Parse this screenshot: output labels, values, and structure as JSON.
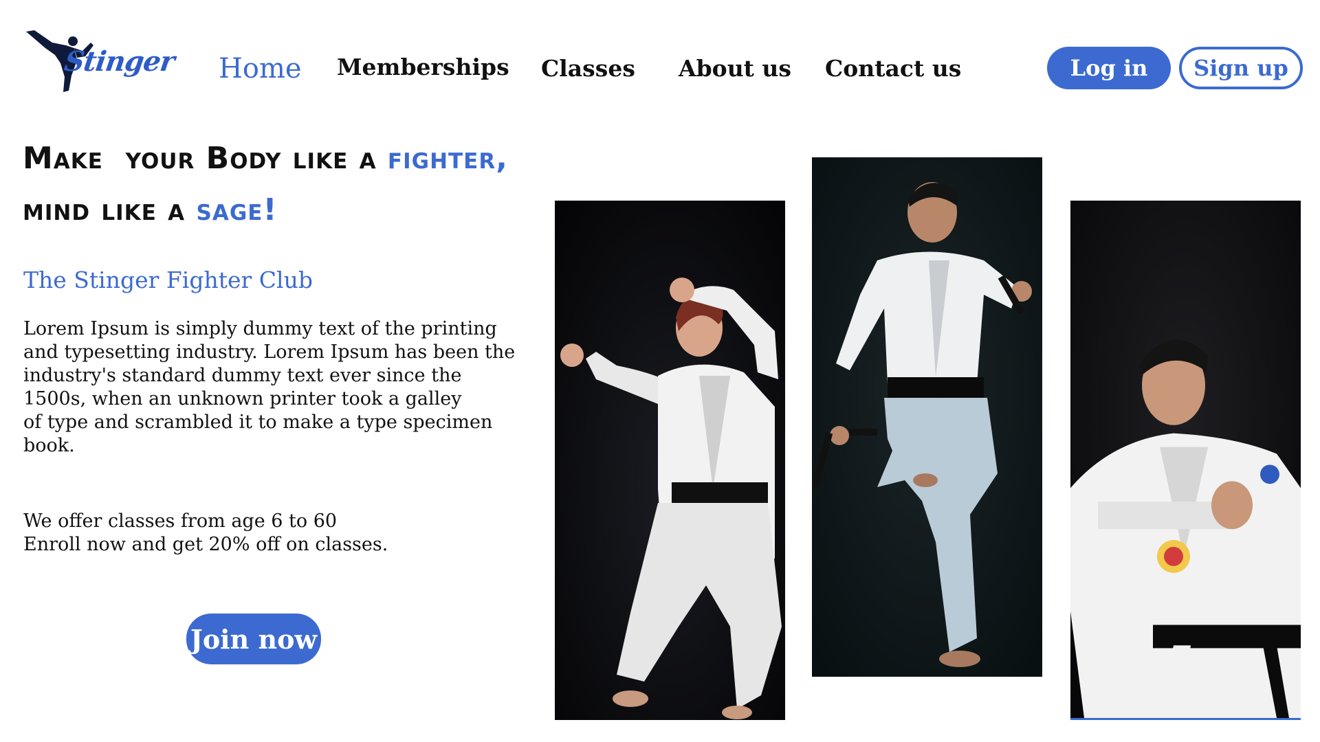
{
  "brand": {
    "logo_text": "Stinger",
    "logo_icon": "karate-kick-silhouette-icon"
  },
  "nav": {
    "items": [
      {
        "label": "Home",
        "active": true
      },
      {
        "label": "Memberships"
      },
      {
        "label": "Classes"
      },
      {
        "label": "About us"
      },
      {
        "label": "Contact us"
      }
    ],
    "login_label": "Log in",
    "signup_label": "Sign up"
  },
  "hero": {
    "headline_line1_prefix": "Make  your Body like a ",
    "headline_line1_accent": "fighter,",
    "headline_line2_prefix": "mind like a ",
    "headline_line2_accent": "sage!",
    "club_title": "The Stinger Fighter Club",
    "body_lines": [
      "Lorem Ipsum is simply dummy text of the printing",
      "and typesetting industry. Lorem Ipsum has been the",
      "industry's standard dummy text ever since the",
      "1500s, when an unknown printer took a galley",
      "of type and scrambled it to make a type specimen",
      "book."
    ],
    "offer_lines": [
      "We offer classes from age 6 to 60",
      "Enroll now and get 20% off on classes."
    ],
    "join_label": "Join now"
  },
  "photos": [
    {
      "icon": "karate-woman-photo"
    },
    {
      "icon": "karate-man-nunchaku-photo"
    },
    {
      "icon": "karate-man-guard-photo"
    }
  ],
  "colors": {
    "accent": "#3c6ad0",
    "text": "#111111",
    "photo_bg": "#0b0c10"
  }
}
